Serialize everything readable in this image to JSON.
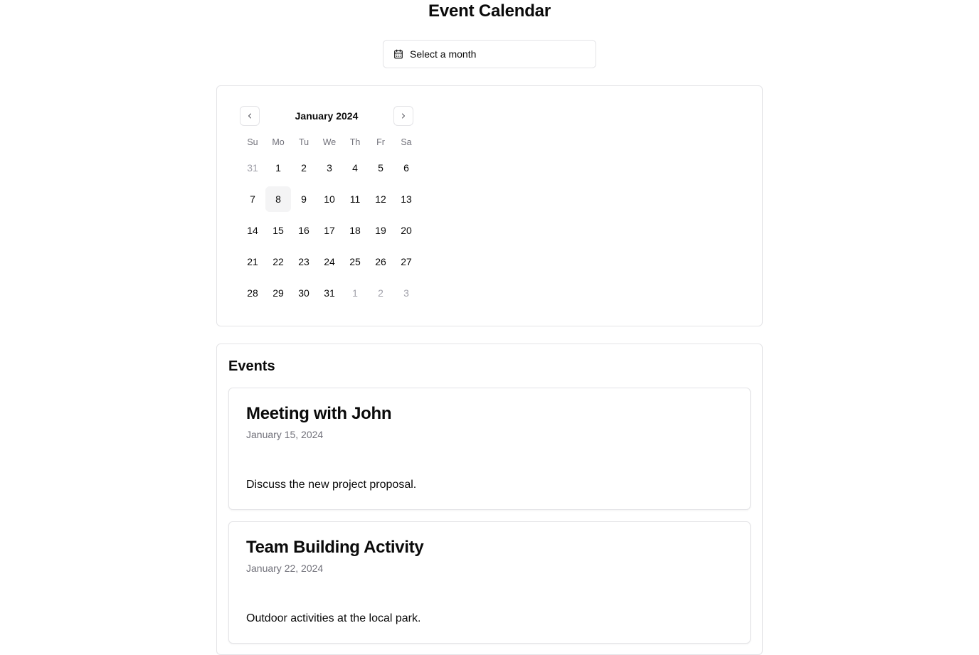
{
  "page": {
    "title": "Event Calendar"
  },
  "month_picker": {
    "label": "Select a month",
    "icon": "calendar-icon"
  },
  "calendar": {
    "caption": "January 2024",
    "prev_icon": "chevron-left-icon",
    "next_icon": "chevron-right-icon",
    "weekdays": [
      "Su",
      "Mo",
      "Tu",
      "We",
      "Th",
      "Fr",
      "Sa"
    ],
    "today": "8",
    "weeks": [
      [
        {
          "d": "31",
          "outside": true
        },
        {
          "d": "1"
        },
        {
          "d": "2"
        },
        {
          "d": "3"
        },
        {
          "d": "4"
        },
        {
          "d": "5"
        },
        {
          "d": "6"
        }
      ],
      [
        {
          "d": "7"
        },
        {
          "d": "8",
          "today": true
        },
        {
          "d": "9"
        },
        {
          "d": "10"
        },
        {
          "d": "11"
        },
        {
          "d": "12"
        },
        {
          "d": "13"
        }
      ],
      [
        {
          "d": "14"
        },
        {
          "d": "15"
        },
        {
          "d": "16"
        },
        {
          "d": "17"
        },
        {
          "d": "18"
        },
        {
          "d": "19"
        },
        {
          "d": "20"
        }
      ],
      [
        {
          "d": "21"
        },
        {
          "d": "22"
        },
        {
          "d": "23"
        },
        {
          "d": "24"
        },
        {
          "d": "25"
        },
        {
          "d": "26"
        },
        {
          "d": "27"
        }
      ],
      [
        {
          "d": "28"
        },
        {
          "d": "29"
        },
        {
          "d": "30"
        },
        {
          "d": "31"
        },
        {
          "d": "1",
          "outside": true
        },
        {
          "d": "2",
          "outside": true
        },
        {
          "d": "3",
          "outside": true
        }
      ]
    ]
  },
  "events": {
    "title": "Events",
    "items": [
      {
        "title": "Meeting with John",
        "date": "January 15, 2024",
        "description": "Discuss the new project proposal."
      },
      {
        "title": "Team Building Activity",
        "date": "January 22, 2024",
        "description": "Outdoor activities at the local park."
      }
    ]
  },
  "colors": {
    "border": "#e4e4e7",
    "muted_text": "#71717a",
    "outside_day": "#a1a1aa",
    "today_bg": "#f4f4f5",
    "text": "#0a0a0a"
  }
}
